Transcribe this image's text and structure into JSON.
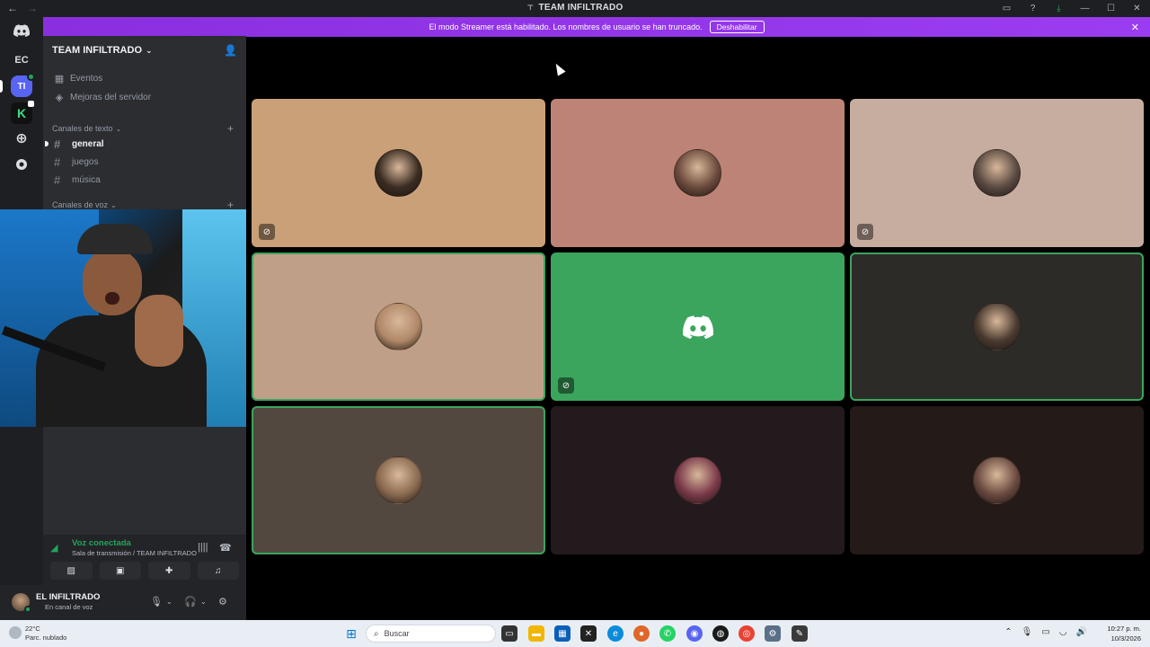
{
  "window": {
    "title": "TEAM INFILTRADO"
  },
  "rail": {
    "items": [
      {
        "label": ""
      },
      {
        "label": "EC"
      },
      {
        "label": "TI"
      },
      {
        "label": "K"
      }
    ]
  },
  "server": {
    "name": "TEAM INFILTRADO",
    "events_label": "Eventos",
    "boosts_label": "Mejoras del servidor",
    "text_category": "Canales de texto",
    "voice_category": "Canales de voz",
    "channels": [
      {
        "name": "general"
      },
      {
        "name": "juegos"
      },
      {
        "name": "música"
      }
    ]
  },
  "banner": {
    "text": "El modo Streamer está habilitado. Los nombres de usuario se han truncado.",
    "button": "Deshabilitar"
  },
  "voice": {
    "status": "Voz conectada",
    "location": "Sala de transmisión / TEAM INFILTRADO"
  },
  "user": {
    "name": "EL INFILTRADO",
    "status": "En canal de voz"
  },
  "tiles": [
    {
      "color": "#c9a078",
      "muted": true,
      "speaking": false,
      "avatar": "#3a2c22"
    },
    {
      "color": "#bd8376",
      "muted": false,
      "speaking": false,
      "avatar": "#6b4a3c"
    },
    {
      "color": "#c7ada0",
      "muted": true,
      "speaking": false,
      "avatar": "#5a4a42"
    },
    {
      "color": "#c09f88",
      "muted": false,
      "speaking": true,
      "avatar": "#b08868"
    },
    {
      "color": "#3ba55d",
      "muted": true,
      "speaking": false,
      "avatar": "discord"
    },
    {
      "color": "#2d2b28",
      "muted": false,
      "speaking": true,
      "avatar": "#4a3a30"
    },
    {
      "color": "#534840",
      "muted": false,
      "speaking": true,
      "avatar": "#8a6a50"
    },
    {
      "color": "#221a1c",
      "muted": false,
      "speaking": false,
      "avatar": "#7a3a4a"
    },
    {
      "color": "#241a18",
      "muted": false,
      "speaking": false,
      "avatar": "#6a4a40"
    }
  ],
  "taskbar": {
    "weather_temp": "22°C",
    "weather_desc": "Parc. nublado",
    "search_placeholder": "Buscar",
    "time": "10:27 p. m.",
    "date": "10/3/2026"
  }
}
